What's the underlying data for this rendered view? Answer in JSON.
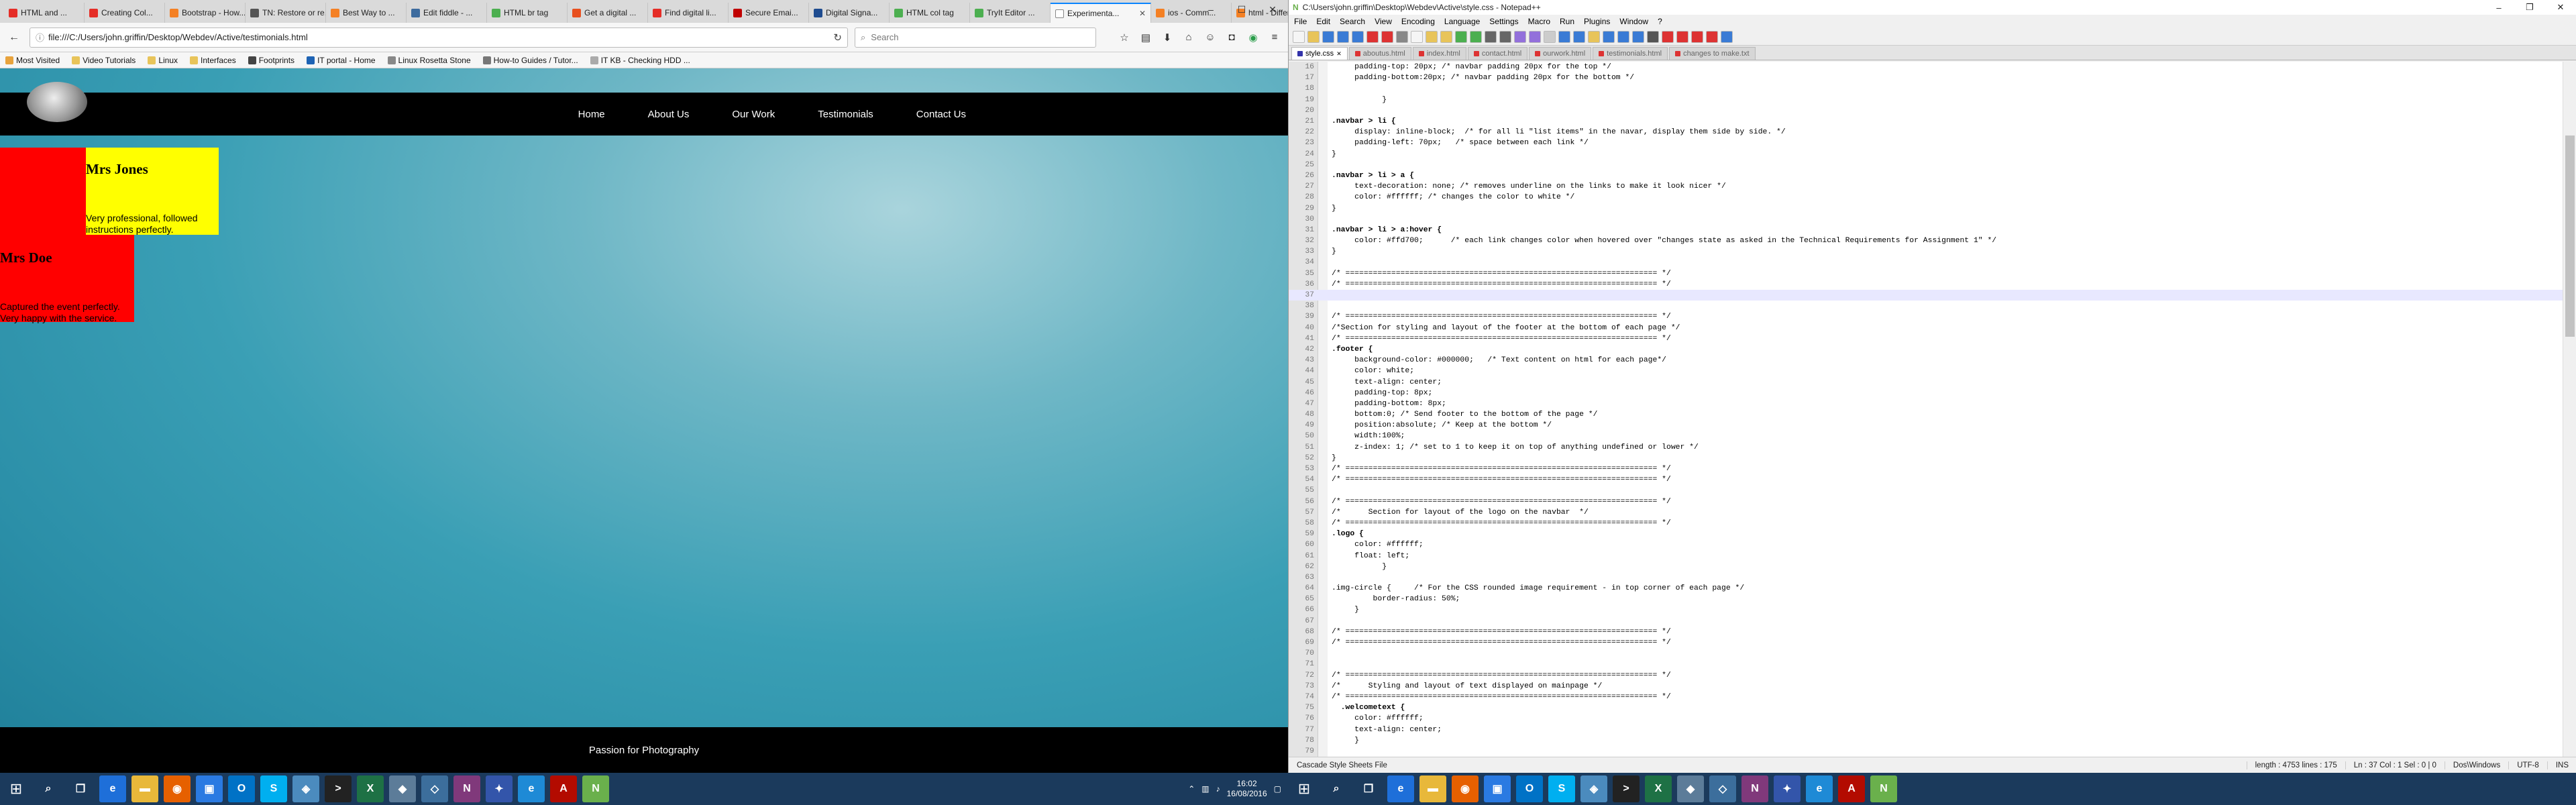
{
  "browser": {
    "tabs": [
      {
        "label": "HTML and ...",
        "color": "#e52d27",
        "icon": "youtube-icon"
      },
      {
        "label": "Creating Col...",
        "color": "#e52d27",
        "icon": "youtube-icon"
      },
      {
        "label": "Bootstrap - How...",
        "color": "#f48024",
        "icon": "stackoverflow-icon"
      },
      {
        "label": "TN: Restore or re...",
        "color": "#555555",
        "icon": "page-icon"
      },
      {
        "label": "Best Way to ...",
        "color": "#f48024",
        "icon": "stackoverflow-icon"
      },
      {
        "label": "Edit fiddle - ...",
        "color": "#3d6b9e",
        "icon": "jsfiddle-icon"
      },
      {
        "label": "HTML br tag",
        "color": "#4caf50",
        "icon": "w3-icon"
      },
      {
        "label": "Get a digital ...",
        "color": "#e8501f",
        "icon": "page-icon"
      },
      {
        "label": "Find digital li...",
        "color": "#e52d27",
        "icon": "page-icon"
      },
      {
        "label": "Secure Emai...",
        "color": "#c00000",
        "icon": "page-icon"
      },
      {
        "label": "Digital Signa...",
        "color": "#1e4b8f",
        "icon": "page-icon"
      },
      {
        "label": "HTML col tag",
        "color": "#4caf50",
        "icon": "w3-icon"
      },
      {
        "label": "TryIt Editor ...",
        "color": "#4caf50",
        "icon": "w3-icon"
      },
      {
        "label": "Experimenta...",
        "color": "#ffffff",
        "icon": "page-icon"
      },
      {
        "label": "ios - Comm...",
        "color": "#f48024",
        "icon": "stackoverflow-icon"
      },
      {
        "label": "html - Differ...",
        "color": "#f48024",
        "icon": "stackoverflow-icon"
      }
    ],
    "active_tab": 13,
    "url": "file:///C:/Users/john.griffin/Desktop/Webdev/Active/testimonials.html",
    "search_placeholder": "Search",
    "bookmarks": [
      {
        "label": "Most Visited",
        "color": "#e8a33d"
      },
      {
        "label": "Video Tutorials",
        "color": "#e8c45a"
      },
      {
        "label": "Linux",
        "color": "#e8c45a"
      },
      {
        "label": "Interfaces",
        "color": "#e8c45a"
      },
      {
        "label": "Footprints",
        "color": "#444444"
      },
      {
        "label": "IT portal - Home",
        "color": "#1e63b4"
      },
      {
        "label": "Linux Rosetta Stone",
        "color": "#888888"
      },
      {
        "label": "How-to Guides / Tutor...",
        "color": "#777777"
      },
      {
        "label": "IT KB - Checking HDD ...",
        "color": "#aaaaaa"
      }
    ]
  },
  "site": {
    "nav": [
      "Home",
      "About Us",
      "Our Work",
      "Testimonials",
      "Contact Us"
    ],
    "testimonials": [
      {
        "name": "Mrs Jones",
        "text": "Very professional, followed instructions perfectly."
      },
      {
        "name": "Mrs Doe",
        "text": "Captured the event perfectly. Very happy with the service."
      }
    ],
    "footer": "Passion for Photography"
  },
  "notepad": {
    "title": "C:\\Users\\john.griffin\\Desktop\\Webdev\\Active\\style.css - Notepad++",
    "menu": [
      "File",
      "Edit",
      "Search",
      "View",
      "Encoding",
      "Language",
      "Settings",
      "Macro",
      "Run",
      "Plugins",
      "Window",
      "?"
    ],
    "tabs": [
      "style.css",
      "aboutus.html",
      "index.html",
      "contact.html",
      "ourwork.html",
      "testimonials.html",
      "changes to make.txt"
    ],
    "active_tab": 0,
    "status": {
      "filetype": "Cascade Style Sheets File",
      "length": "length : 4753    lines : 175",
      "position": "Ln : 37    Col : 1    Sel : 0 | 0",
      "eol": "Dos\\Windows",
      "encoding": "UTF-8",
      "mode": "INS"
    },
    "lines": [
      {
        "n": "16",
        "t": "     padding-top: 20px; /* navbar padding 20px for the top */"
      },
      {
        "n": "17",
        "t": "     padding-bottom:20px; /* navbar padding 20px for the bottom */"
      },
      {
        "n": "18",
        "t": ""
      },
      {
        "n": "19",
        "t": "           }"
      },
      {
        "n": "20",
        "t": ""
      },
      {
        "n": "21",
        "t": ".navbar > li {"
      },
      {
        "n": "22",
        "t": "     display: inline-block;  /* for all li \"list items\" in the navar, display them side by side. */"
      },
      {
        "n": "23",
        "t": "     padding-left: 70px;   /* space between each link */"
      },
      {
        "n": "24",
        "t": "}"
      },
      {
        "n": "25",
        "t": ""
      },
      {
        "n": "26",
        "t": ".navbar > li > a {"
      },
      {
        "n": "27",
        "t": "     text-decoration: none; /* removes underline on the links to make it look nicer */"
      },
      {
        "n": "28",
        "t": "     color: #ffffff; /* changes the color to white */"
      },
      {
        "n": "29",
        "t": "}"
      },
      {
        "n": "30",
        "t": ""
      },
      {
        "n": "31",
        "t": ".navbar > li > a:hover {"
      },
      {
        "n": "32",
        "t": "     color: #ffd700;      /* each link changes color when hovered over \"changes state as asked in the Technical Requirements for Assignment 1\" */"
      },
      {
        "n": "33",
        "t": "}"
      },
      {
        "n": "34",
        "t": ""
      },
      {
        "n": "35",
        "t": "/* ==================================================================== */"
      },
      {
        "n": "36",
        "t": "/* ==================================================================== */"
      },
      {
        "n": "37",
        "t": ""
      },
      {
        "n": "38",
        "t": ""
      },
      {
        "n": "39",
        "t": "/* ==================================================================== */"
      },
      {
        "n": "40",
        "t": "/*Section for styling and layout of the footer at the bottom of each page */"
      },
      {
        "n": "41",
        "t": "/* ==================================================================== */"
      },
      {
        "n": "42",
        "t": ".footer {"
      },
      {
        "n": "43",
        "t": "     background-color: #000000;   /* Text content on html for each page*/"
      },
      {
        "n": "44",
        "t": "     color: white;"
      },
      {
        "n": "45",
        "t": "     text-align: center;"
      },
      {
        "n": "46",
        "t": "     padding-top: 8px;"
      },
      {
        "n": "47",
        "t": "     padding-bottom: 8px;"
      },
      {
        "n": "48",
        "t": "     bottom:0; /* Send footer to the bottom of the page */"
      },
      {
        "n": "49",
        "t": "     position:absolute; /* Keep at the bottom */"
      },
      {
        "n": "50",
        "t": "     width:100%;"
      },
      {
        "n": "51",
        "t": "     z-index: 1; /* set to 1 to keep it on top of anything undefined or lower */"
      },
      {
        "n": "52",
        "t": "}"
      },
      {
        "n": "53",
        "t": "/* ==================================================================== */"
      },
      {
        "n": "54",
        "t": "/* ==================================================================== */"
      },
      {
        "n": "55",
        "t": ""
      },
      {
        "n": "56",
        "t": "/* ==================================================================== */"
      },
      {
        "n": "57",
        "t": "/*      Section for layout of the logo on the navbar  */"
      },
      {
        "n": "58",
        "t": "/* ==================================================================== */"
      },
      {
        "n": "59",
        "t": ".logo {"
      },
      {
        "n": "60",
        "t": "     color: #ffffff;"
      },
      {
        "n": "61",
        "t": "     float: left;"
      },
      {
        "n": "62",
        "t": "           }"
      },
      {
        "n": "63",
        "t": ""
      },
      {
        "n": "64",
        "t": ".img-circle {     /* For the CSS rounded image requirement - in top corner of each page */"
      },
      {
        "n": "65",
        "t": "         border-radius: 50%;"
      },
      {
        "n": "66",
        "t": "     }"
      },
      {
        "n": "67",
        "t": ""
      },
      {
        "n": "68",
        "t": "/* ==================================================================== */"
      },
      {
        "n": "69",
        "t": "/* ==================================================================== */"
      },
      {
        "n": "70",
        "t": ""
      },
      {
        "n": "71",
        "t": ""
      },
      {
        "n": "72",
        "t": "/* ==================================================================== */"
      },
      {
        "n": "73",
        "t": "/*      Styling and layout of text displayed on mainpage */"
      },
      {
        "n": "74",
        "t": "/* ==================================================================== */"
      },
      {
        "n": "75",
        "t": "  .welcometext {"
      },
      {
        "n": "76",
        "t": "     color: #ffffff;"
      },
      {
        "n": "77",
        "t": "     text-align: center;"
      },
      {
        "n": "78",
        "t": "     }"
      },
      {
        "n": "79",
        "t": ""
      },
      {
        "n": "80",
        "t": "/* ==================================================================== */"
      }
    ],
    "current_line_index": 21
  },
  "taskbar": {
    "time": "16:02",
    "date": "16/08/2016",
    "apps": [
      {
        "icon": "search-icon",
        "color": "#1b3a5c",
        "glyph": "⌕"
      },
      {
        "icon": "task-view-icon",
        "color": "#1b3a5c",
        "glyph": "❐"
      },
      {
        "icon": "edge-icon",
        "color": "#1e6fd9",
        "glyph": "e"
      },
      {
        "icon": "file-explorer-icon",
        "color": "#e8b83a",
        "glyph": "▬"
      },
      {
        "icon": "firefox-icon",
        "color": "#e66000",
        "glyph": "◉"
      },
      {
        "icon": "store-icon",
        "color": "#2a7ae2",
        "glyph": "▣"
      },
      {
        "icon": "outlook-icon",
        "color": "#0072c6",
        "glyph": "O"
      },
      {
        "icon": "skype-icon",
        "color": "#00aff0",
        "glyph": "S"
      },
      {
        "icon": "app-icon",
        "color": "#4b8bbe",
        "glyph": "◈"
      },
      {
        "icon": "terminal-icon",
        "color": "#222222",
        "glyph": ">"
      },
      {
        "icon": "excel-icon",
        "color": "#1e7145",
        "glyph": "X"
      },
      {
        "icon": "app2-icon",
        "color": "#5c7c99",
        "glyph": "◆"
      },
      {
        "icon": "app3-icon",
        "color": "#3c6e9c",
        "glyph": "◇"
      },
      {
        "icon": "onenote-icon",
        "color": "#80397b",
        "glyph": "N"
      },
      {
        "icon": "app4-icon",
        "color": "#3355aa",
        "glyph": "✦"
      },
      {
        "icon": "ie-icon",
        "color": "#1e8ad6",
        "glyph": "e"
      },
      {
        "icon": "acrobat-icon",
        "color": "#b30b00",
        "glyph": "A"
      },
      {
        "icon": "notepadpp-icon",
        "color": "#6ab04c",
        "glyph": "N"
      }
    ]
  }
}
